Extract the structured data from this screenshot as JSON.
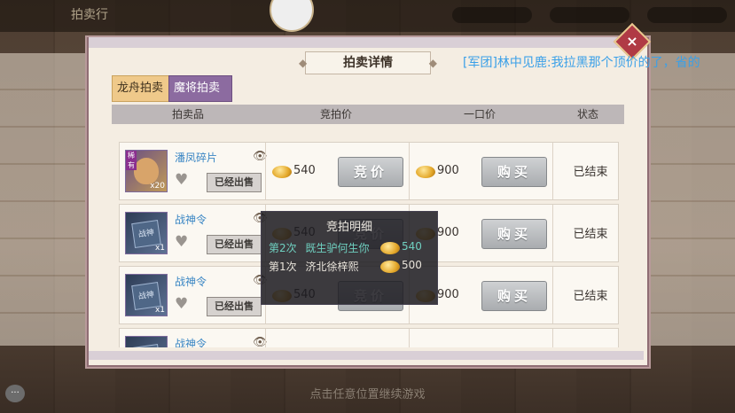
{
  "background": {
    "title": "拍卖行"
  },
  "chat_message": "[军团]林中见鹿:我拉黑那个顶价的了，省的",
  "panel": {
    "title": "拍卖详情",
    "close_icon": "×"
  },
  "tabs": [
    {
      "label": "龙舟拍卖",
      "active": true
    },
    {
      "label": "魔将拍卖",
      "active": false
    }
  ],
  "table": {
    "headers": [
      "拍卖品",
      "竞拍价",
      "一口价",
      "状态"
    ],
    "rows": [
      {
        "name": "潘凤碎片",
        "qty": "x20",
        "badge": "稀有",
        "sold_label": "已经出售",
        "bid_price": "540",
        "bid_button": "竞价",
        "buy_price": "900",
        "buy_button": "购买",
        "status": "已结束"
      },
      {
        "name": "战神令",
        "qty": "x1",
        "flag_text": "战神",
        "sold_label": "已经出售",
        "bid_price": "540",
        "bid_button": "竞价",
        "buy_price": "900",
        "buy_button": "购买",
        "status": "已结束"
      },
      {
        "name": "战神令",
        "qty": "x1",
        "flag_text": "战神",
        "sold_label": "已经出售",
        "bid_price": "540",
        "bid_button": "竞价",
        "buy_price": "900",
        "buy_button": "购买",
        "status": "已结束"
      },
      {
        "name": "战神令",
        "qty": "x1",
        "flag_text": "战神",
        "sold_label": "",
        "bid_price": "",
        "bid_button": "",
        "buy_price": "",
        "buy_button": "",
        "status": ""
      }
    ]
  },
  "bid_popup": {
    "title": "竞拍明细",
    "entries": [
      {
        "round": "第2次",
        "bidder": "既生驴何生你",
        "amount": "540"
      },
      {
        "round": "第1次",
        "bidder": "济北徐梓熙",
        "amount": "500"
      }
    ]
  },
  "hint": "点击任意位置继续游戏",
  "chat_icon": "···"
}
